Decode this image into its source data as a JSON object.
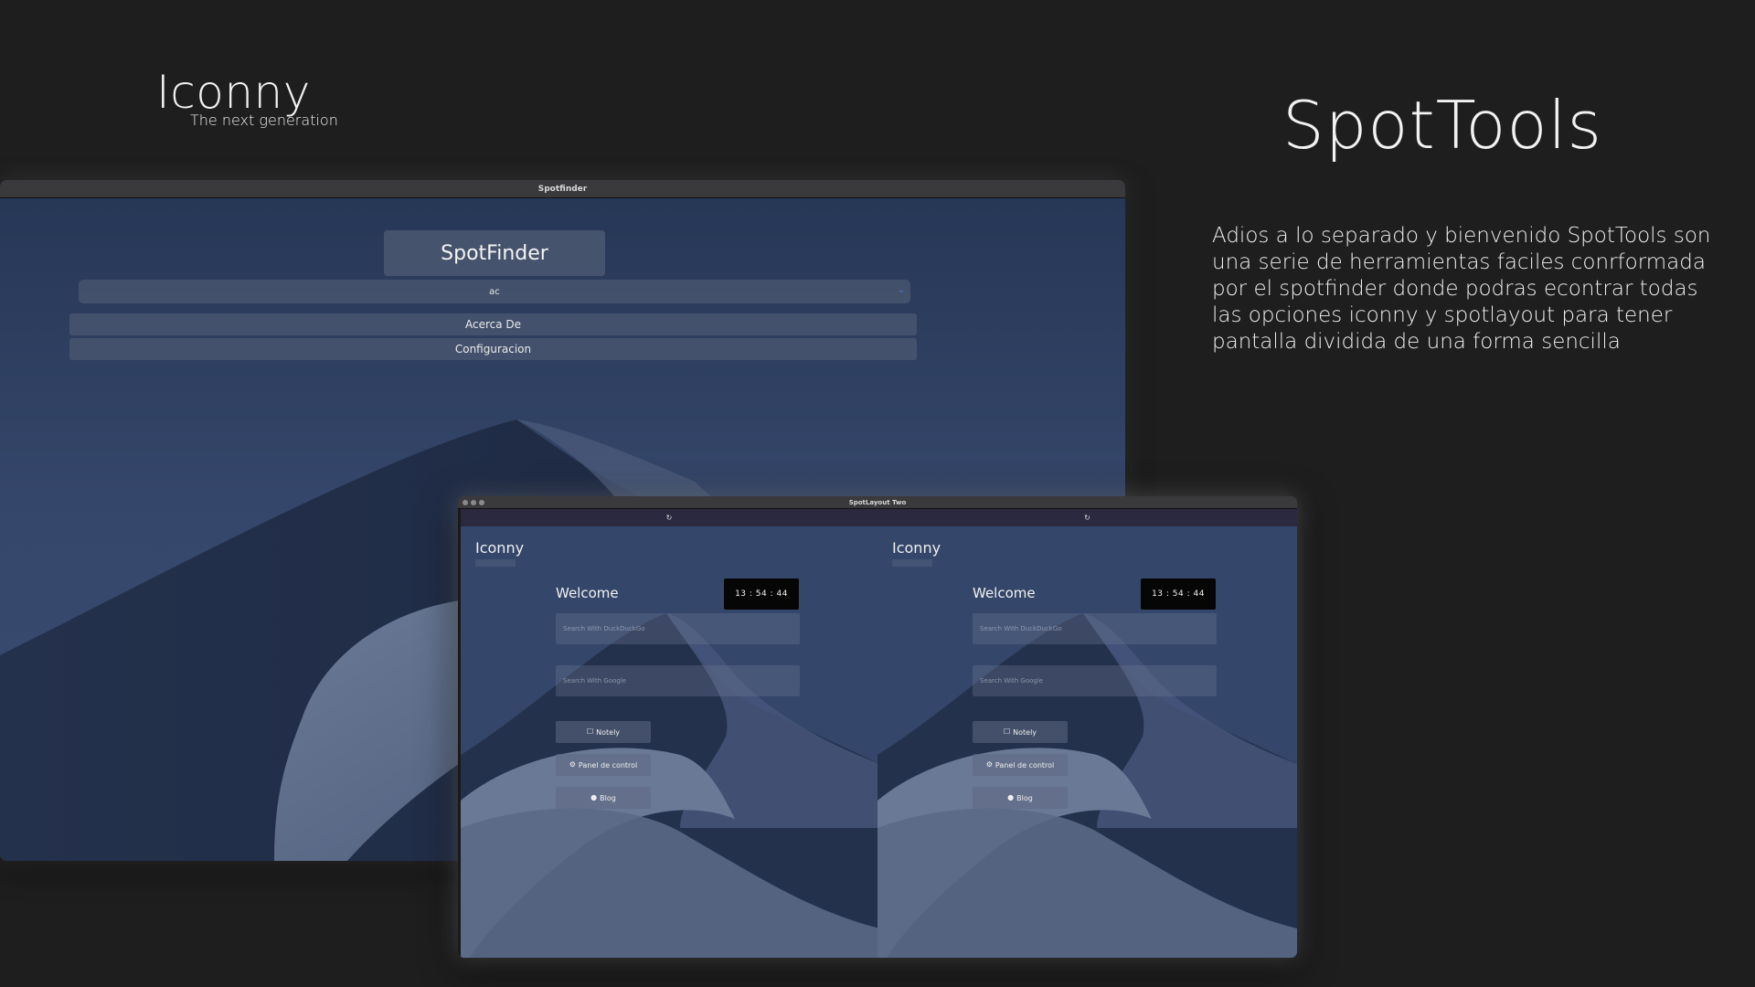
{
  "brand": {
    "title": "Iconny",
    "subtitle": "The next generation"
  },
  "product": {
    "title": "SpotTools",
    "description": "Adios a lo  separado y bienvenido SpotTools son una serie de herramientas faciles conrformada por el spotfinder donde podras econtrar todas las opciones iconny y spotlayout para tener pantalla dividida de una forma sencilla"
  },
  "spotfinder_window": {
    "window_title": "Spotfinder",
    "app_title": "SpotFinder",
    "select_value": "ac",
    "buttons": [
      "Acerca De",
      "Configuracion"
    ]
  },
  "spotlayout_window": {
    "window_title": "SpotLayout Two",
    "panes": [
      {
        "reload_glyph": "↻",
        "logo": "Iconny",
        "welcome": "Welcome",
        "clock": "13 : 54 : 44",
        "search_placeholder": "Search With DuckDuckGo",
        "google_placeholder": "Search With Google",
        "buttons": {
          "notely": "Notely",
          "panel": "Panel de control",
          "blog": "Blog"
        }
      },
      {
        "reload_glyph": "↻",
        "logo": "Iconny",
        "welcome": "Welcome",
        "clock": "13 : 54 : 44",
        "search_placeholder": "Search With DuckDuckGo",
        "google_placeholder": "Search With Google",
        "buttons": {
          "notely": "Notely",
          "panel": "Panel de control",
          "blog": "Blog"
        }
      }
    ]
  },
  "icons": {
    "notely": "note-icon",
    "panel": "gear-icon",
    "blog": "globe-icon",
    "select": "chevron-down-icon"
  },
  "colors": {
    "page_background": "#1f1e1f",
    "wallpaper_sky": "#34466a",
    "clock_background": "#060606"
  }
}
